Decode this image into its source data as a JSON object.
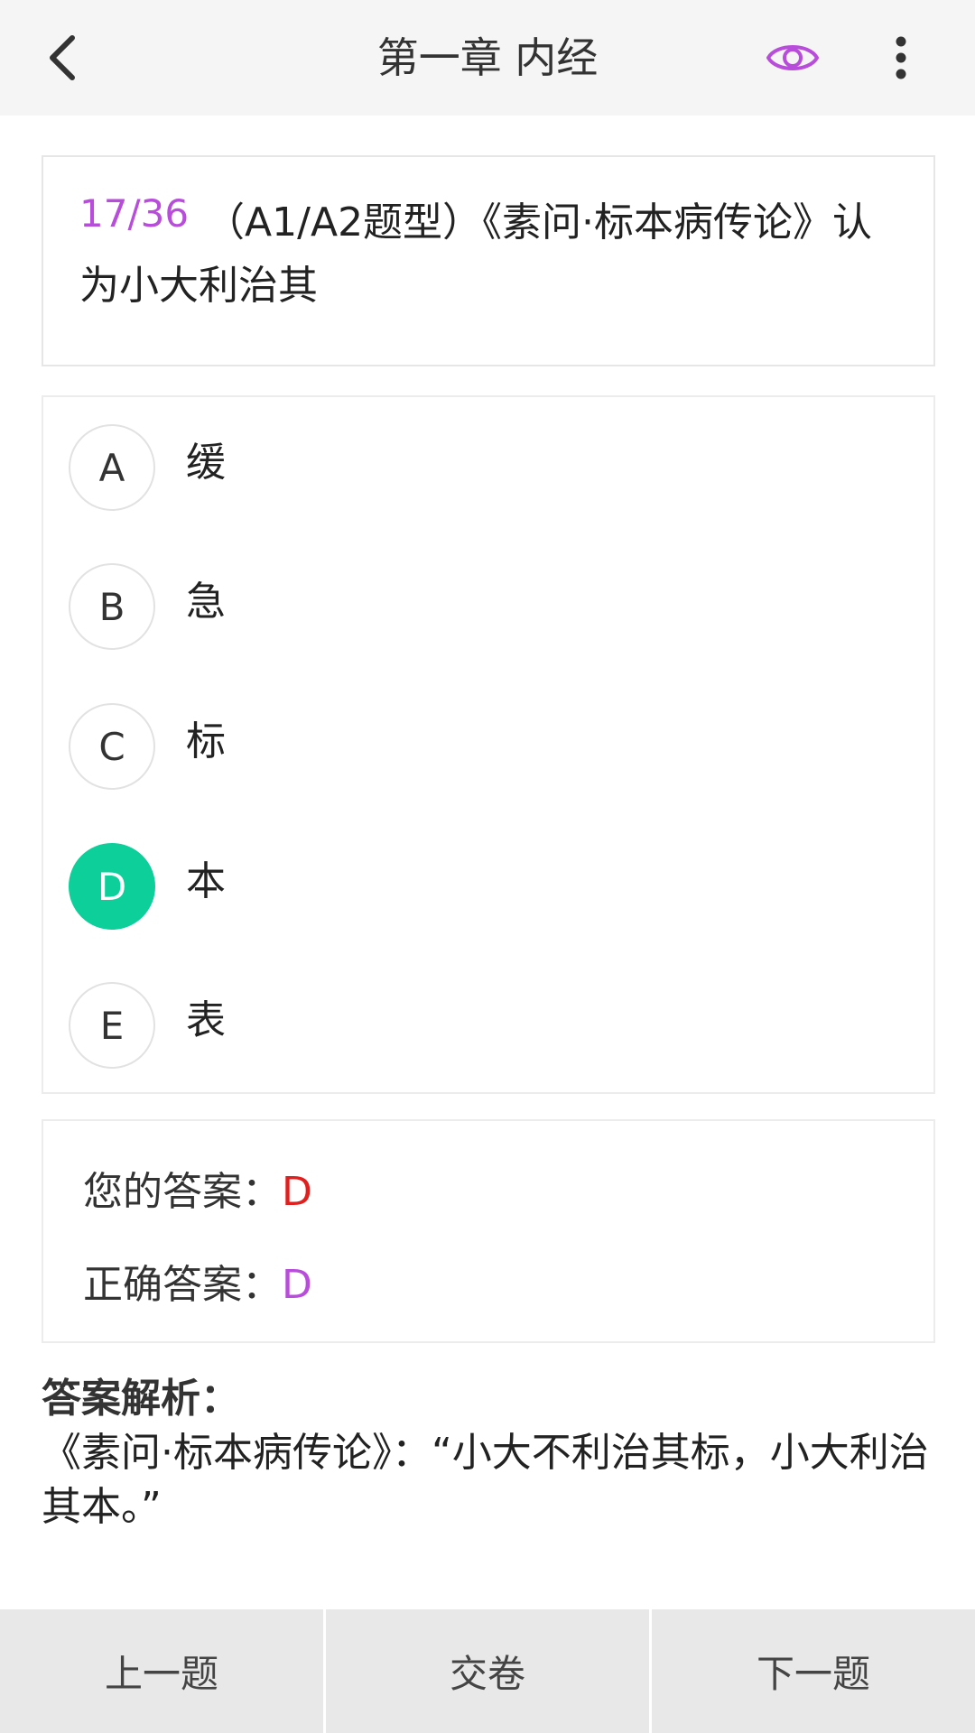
{
  "header": {
    "title": "第一章 内经",
    "back_icon": "chevron-left",
    "view_icon": "eye",
    "more_icon": "vertical-dots",
    "accent_color": "#b84ddb"
  },
  "question": {
    "index": "17/36",
    "text": "（A1/A2题型）《素问·标本病传论》认为小大利治其"
  },
  "options": [
    {
      "letter": "A",
      "text": "缓",
      "selected": false
    },
    {
      "letter": "B",
      "text": "急",
      "selected": false
    },
    {
      "letter": "C",
      "text": "标",
      "selected": false
    },
    {
      "letter": "D",
      "text": "本",
      "selected": true
    },
    {
      "letter": "E",
      "text": "表",
      "selected": false
    }
  ],
  "answers": {
    "your_label": "您的答案：",
    "your_value": "D",
    "correct_label": "正确答案：",
    "correct_value": "D"
  },
  "analysis": {
    "title": "答案解析：",
    "body": "《素问·标本病传论》：“小大不利治其标，小大利治其本。”"
  },
  "footer": {
    "prev": "上一题",
    "submit": "交卷",
    "next": "下一题"
  },
  "colors": {
    "selected_option": "#0ccf9a",
    "your_answer": "#e0201f",
    "correct_answer": "#b84ddb"
  }
}
